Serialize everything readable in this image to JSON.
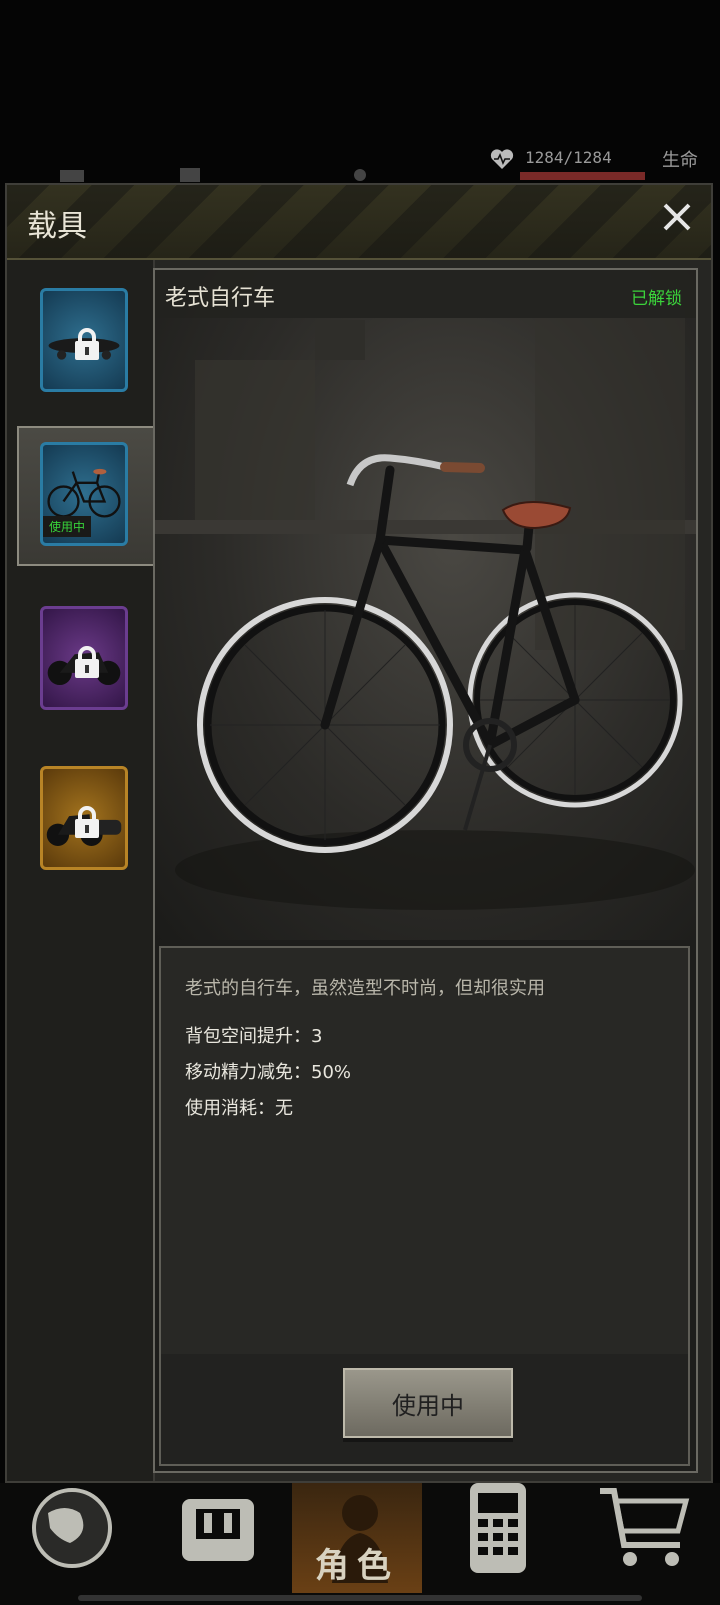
{
  "status": {
    "hp_value": "1284/1284",
    "hp_label": "生命",
    "hp_fraction": 1.0
  },
  "panel": {
    "title": "载具"
  },
  "vehicles": [
    {
      "id": "skateboard",
      "locked": true,
      "theme": "blue"
    },
    {
      "id": "bicycle",
      "locked": false,
      "selected": true,
      "tag": "使用中",
      "theme": "blue"
    },
    {
      "id": "motorcycle",
      "locked": true,
      "theme": "purple"
    },
    {
      "id": "sidecar-motorcycle",
      "locked": true,
      "theme": "gold"
    }
  ],
  "detail": {
    "name": "老式自行车",
    "unlock_status": "已解锁",
    "description": "老式的自行车，虽然造型不时尚，但却很实用",
    "stats": [
      "背包空间提升：3",
      "移动精力减免：50%",
      "使用消耗：无"
    ],
    "action_button": "使用中"
  },
  "nav": {
    "active_label": "角色"
  },
  "colors": {
    "accent_green": "#3bd33b",
    "hp_red": "#7a2a28",
    "panel_bg": "#262623"
  }
}
